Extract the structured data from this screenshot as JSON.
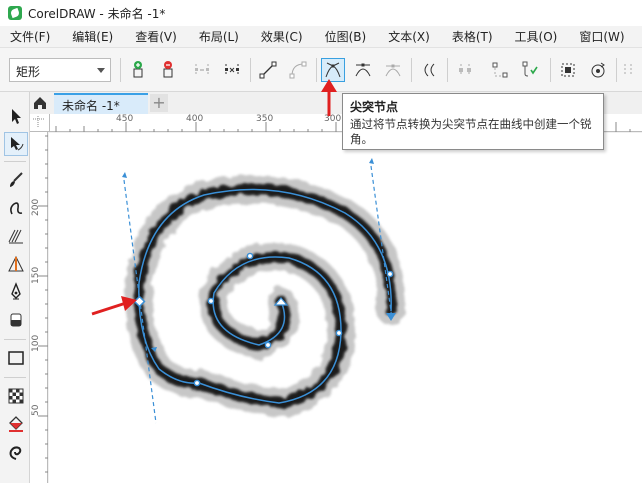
{
  "window": {
    "title": "CorelDRAW - 未命名 -1*"
  },
  "menubar": {
    "items": [
      {
        "label": "文件(F)"
      },
      {
        "label": "编辑(E)"
      },
      {
        "label": "查看(V)"
      },
      {
        "label": "布局(L)"
      },
      {
        "label": "效果(C)"
      },
      {
        "label": "位图(B)"
      },
      {
        "label": "文本(X)"
      },
      {
        "label": "表格(T)"
      },
      {
        "label": "工具(O)"
      },
      {
        "label": "窗口(W)"
      }
    ]
  },
  "property_bar": {
    "shape_select": "矩形",
    "tools": [
      "add-node-icon",
      "delete-node-icon",
      "join-nodes-icon",
      "break-curve-icon",
      "to-line-icon",
      "to-curve-icon",
      "cusp-node-icon",
      "smooth-node-icon",
      "symmetrical-node-icon",
      "reverse-direction-icon",
      "extract-subpath-icon",
      "extend-curve-icon",
      "auto-close-icon",
      "stretch-nodes-icon",
      "rotate-nodes-icon",
      "align-nodes-icon"
    ]
  },
  "tabs": {
    "document_tab": "未命名 -1*",
    "add_tab": "+"
  },
  "ruler": {
    "top_labels": [
      "450",
      "400",
      "350",
      "300"
    ],
    "left_labels": [
      "200",
      "150",
      "100",
      "50"
    ]
  },
  "tooltip": {
    "title": "尖突节点",
    "description": "通过将节点转换为尖突节点在曲线中创建一个锐角。"
  },
  "colors": {
    "accent": "#39a0e0",
    "selection_blue": "#3a8fd6",
    "annotation_red": "#e02020",
    "stroke_dark": "#1a1a1a"
  }
}
